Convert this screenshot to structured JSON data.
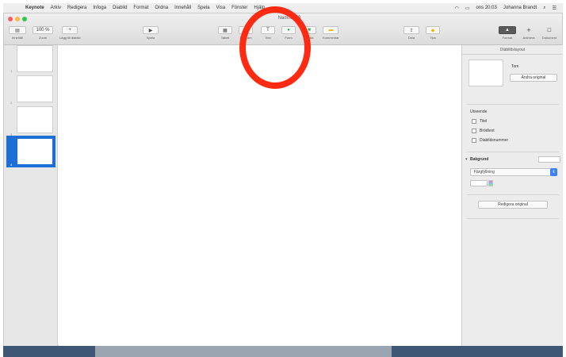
{
  "menubar": {
    "apple": "",
    "items": [
      "Keynote",
      "Arkiv",
      "Redigera",
      "Infoga",
      "Diabild",
      "Format",
      "Ordna",
      "Innehåll",
      "Spela",
      "Visa",
      "Fönster",
      "Hjälp"
    ],
    "clock": "ons 20:03",
    "user": "Johanna Brandt"
  },
  "window": {
    "title": "Namnlös 3",
    "colors": {
      "close": "#fc605c",
      "minimize": "#fdbc40",
      "zoom": "#34c84a"
    }
  },
  "toolbar": {
    "view": {
      "icon": "sidebar-icon",
      "label": "Innehåll"
    },
    "zoom": {
      "value": "100 %",
      "label": "Zoom"
    },
    "add_slide": {
      "icon": "plus-icon",
      "label": "Lägg till diabild"
    },
    "play": {
      "icon": "play-icon",
      "label": "Spela"
    },
    "table": {
      "icon": "table-icon",
      "label": "Tabell"
    },
    "chart": {
      "icon": "chart-icon",
      "label": "Diagram"
    },
    "text": {
      "icon": "text-icon",
      "label": "Text"
    },
    "shape": {
      "icon": "shape-icon",
      "label": "Form"
    },
    "media": {
      "icon": "media-icon",
      "label": "Media"
    },
    "comment": {
      "icon": "comment-icon",
      "label": "Kommentar"
    },
    "share": {
      "icon": "share-icon",
      "label": "Dela"
    },
    "tips": {
      "icon": "lightbulb-icon",
      "label": "Tips"
    },
    "format": {
      "icon": "paintbrush-icon",
      "label": "Format"
    },
    "animate": {
      "icon": "animate-icon",
      "label": "Animera"
    },
    "document": {
      "icon": "document-icon",
      "label": "Dokument"
    }
  },
  "navigator": {
    "slides": [
      "1",
      "2",
      "3",
      "4"
    ],
    "selected_index": 4,
    "accent": "#1d6fd6"
  },
  "inspector": {
    "tab_label": "Diabildslayout",
    "layout_name": "Tom",
    "change_master_label": "Ändra original",
    "appearance_title": "Utseende",
    "checkboxes": [
      "Titel",
      "Brödtext",
      "Diabildsnummer"
    ],
    "background_title": "Bakgrund",
    "fill_type": "Färgfyllning",
    "edit_master_label": "Redigera original"
  }
}
